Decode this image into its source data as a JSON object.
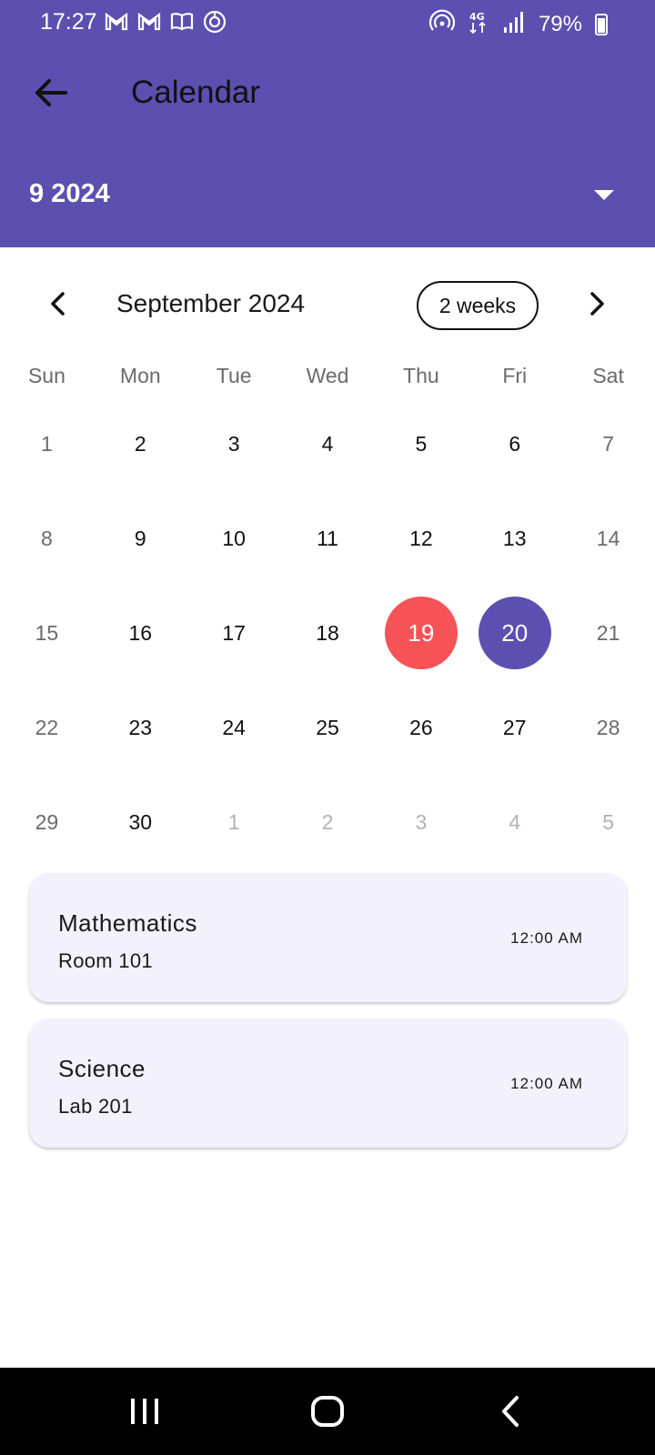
{
  "status_bar": {
    "time": "17:27",
    "battery": "79%",
    "left_icons": [
      "gmail-icon",
      "gmail-icon",
      "book-icon",
      "sync-icon"
    ],
    "right_icons": [
      "hotspot-icon",
      "4g-icon",
      "signal-icon",
      "battery-charging-icon"
    ]
  },
  "appbar": {
    "title": "Calendar",
    "back_icon": "arrow-left-icon"
  },
  "month_selector": {
    "label": "9 2024",
    "icon": "dropdown-triangle-icon"
  },
  "calendar": {
    "title": "September 2024",
    "format_button": "2 weeks",
    "weekdays": [
      "Sun",
      "Mon",
      "Tue",
      "Wed",
      "Thu",
      "Fri",
      "Sat"
    ],
    "weeks": [
      [
        "1",
        "2",
        "3",
        "4",
        "5",
        "6",
        "7"
      ],
      [
        "8",
        "9",
        "10",
        "11",
        "12",
        "13",
        "14"
      ],
      [
        "15",
        "16",
        "17",
        "18",
        "19",
        "20",
        "21"
      ],
      [
        "22",
        "23",
        "24",
        "25",
        "26",
        "27",
        "28"
      ],
      [
        "29",
        "30",
        "1",
        "2",
        "3",
        "4",
        "5"
      ]
    ],
    "today": "19",
    "selected": "20",
    "colors": {
      "today": "#f55357",
      "selected": "#5b4fb0"
    }
  },
  "events": [
    {
      "title": "Mathematics",
      "location": "Room 101",
      "time": "12:00 AM"
    },
    {
      "title": "Science",
      "location": "Lab 201",
      "time": "12:00 AM"
    }
  ],
  "theme": {
    "primary": "#5b4fb0",
    "card_bg": "#f3f1fc"
  }
}
